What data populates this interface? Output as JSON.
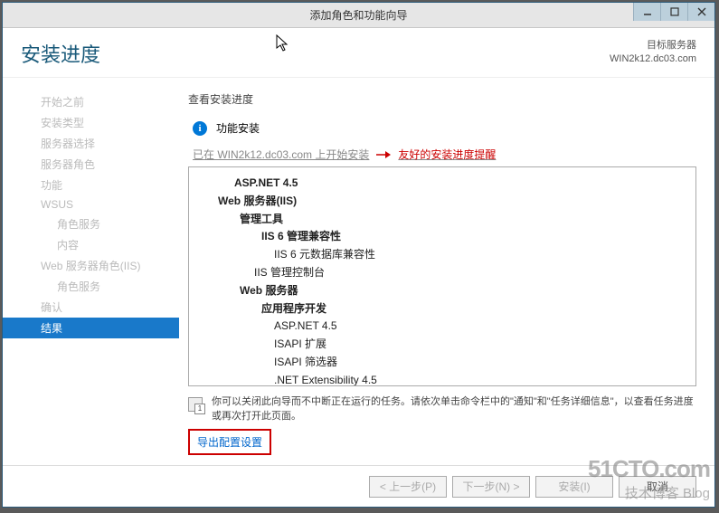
{
  "window_title": "添加角色和功能向导",
  "header": {
    "title": "安装进度",
    "target_label": "目标服务器",
    "target_server": "WIN2k12.dc03.com"
  },
  "sidebar": {
    "items": [
      {
        "label": "开始之前",
        "sub": false
      },
      {
        "label": "安装类型",
        "sub": false
      },
      {
        "label": "服务器选择",
        "sub": false
      },
      {
        "label": "服务器角色",
        "sub": false
      },
      {
        "label": "功能",
        "sub": false
      },
      {
        "label": "WSUS",
        "sub": false
      },
      {
        "label": "角色服务",
        "sub": true
      },
      {
        "label": "内容",
        "sub": true
      },
      {
        "label": "Web 服务器角色(IIS)",
        "sub": false
      },
      {
        "label": "角色服务",
        "sub": true
      },
      {
        "label": "确认",
        "sub": false
      },
      {
        "label": "结果",
        "sub": false,
        "active": true
      }
    ]
  },
  "main": {
    "title": "查看安装进度",
    "info_label": "功能安装",
    "status_text": "已在 WIN2k12.dc03.com 上开始安装",
    "annotation": "友好的安装进度提醒",
    "features": [
      {
        "cls": "l0",
        "text": "ASP.NET 4.5"
      },
      {
        "cls": "l1",
        "text": "Web 服务器(IIS)"
      },
      {
        "cls": "l2",
        "text": "管理工具"
      },
      {
        "cls": "l3",
        "text": "IIS 6 管理兼容性"
      },
      {
        "cls": "l4",
        "text": "IIS 6 元数据库兼容性"
      },
      {
        "cls": "l3n",
        "text": "IIS 管理控制台"
      },
      {
        "cls": "l2",
        "text": "Web 服务器"
      },
      {
        "cls": "l3",
        "text": "应用程序开发"
      },
      {
        "cls": "l4",
        "text": "ASP.NET 4.5"
      },
      {
        "cls": "l4",
        "text": "ISAPI 扩展"
      },
      {
        "cls": "l4",
        "text": "ISAPI 筛选器"
      },
      {
        "cls": "l4",
        "text": ".NET Extensibility 4.5"
      }
    ],
    "note": "你可以关闭此向导而不中断正在运行的任务。请依次单击命令栏中的\"通知\"和\"任务详细信息\"，以查看任务进度或再次打开此页面。",
    "export_link": "导出配置设置"
  },
  "footer": {
    "prev": "< 上一步(P)",
    "next": "下一步(N) >",
    "install": "安装(I)",
    "cancel": "取消"
  },
  "watermark": {
    "line1": "51CTO.com",
    "line2": "技术博客 Blog"
  }
}
